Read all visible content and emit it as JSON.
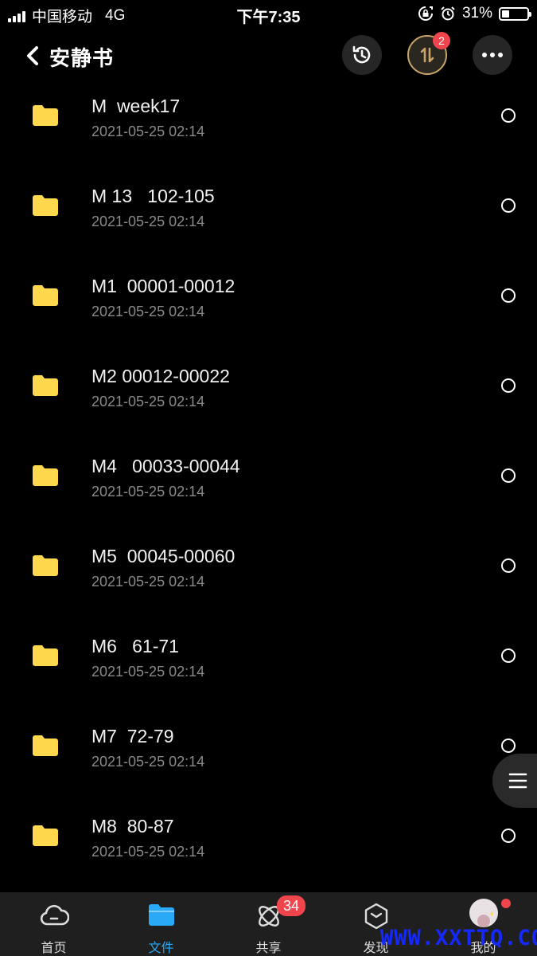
{
  "status_bar": {
    "carrier": "中国移动",
    "network": "4G",
    "time": "下午7:35",
    "battery_percent": "31%",
    "battery_level": 0.31
  },
  "header": {
    "title": "安静书",
    "transfer_badge": "2"
  },
  "files": [
    {
      "name": "M  week17",
      "date": "2021-05-25 02:14"
    },
    {
      "name": "M 13   102-105",
      "date": "2021-05-25 02:14"
    },
    {
      "name": "M1  00001-00012",
      "date": "2021-05-25 02:14"
    },
    {
      "name": "M2 00012-00022",
      "date": "2021-05-25 02:14"
    },
    {
      "name": "M4   00033-00044",
      "date": "2021-05-25 02:14"
    },
    {
      "name": "M5  00045-00060",
      "date": "2021-05-25 02:14"
    },
    {
      "name": "M6   61-71",
      "date": "2021-05-25 02:14"
    },
    {
      "name": "M7  72-79",
      "date": "2021-05-25 02:14"
    },
    {
      "name": "M8  80-87",
      "date": "2021-05-25 02:14"
    }
  ],
  "tabbar": {
    "home": "首页",
    "files": "文件",
    "share": "共享",
    "share_badge": "34",
    "discover": "发现",
    "me": "我的"
  },
  "watermark": "WWW.XXTTQ.COM",
  "colors": {
    "accent": "#2aa9f6",
    "folder": "#ffd84d",
    "badge": "#f0454c",
    "transfer_ring": "#c9a46a"
  }
}
